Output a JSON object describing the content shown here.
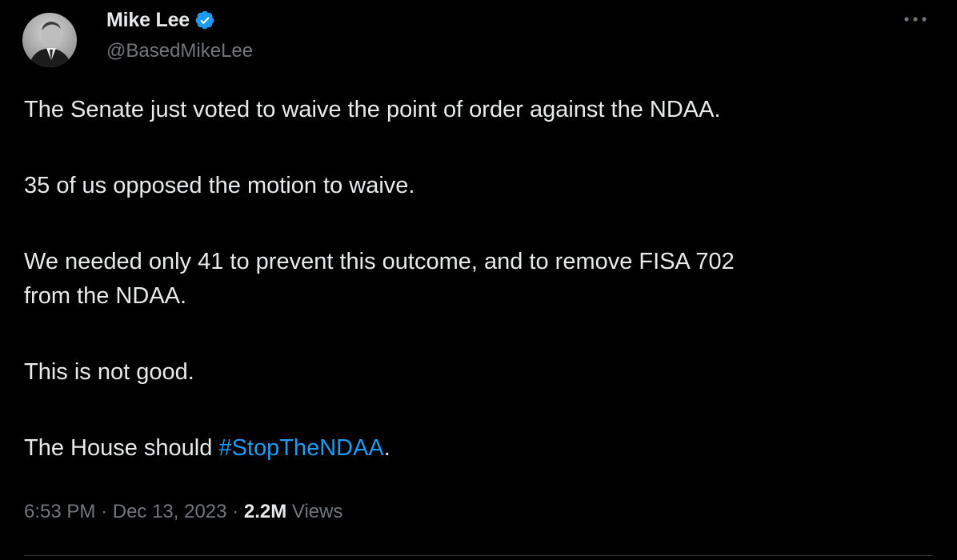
{
  "author": {
    "display_name": "Mike Lee",
    "handle": "@BasedMikeLee",
    "verified": true,
    "verified_color": "#1d9bf0"
  },
  "menu": {
    "icon": "more-horizontal-icon"
  },
  "tweet": {
    "paragraphs": [
      "The Senate just voted to waive the point of order against the NDAA.",
      "35 of us opposed the motion to waive.",
      "We needed only 41 to prevent this outcome, and to remove FISA 702",
      "from the NDAA.",
      "This is not good."
    ],
    "last_line_prefix": "The House should ",
    "hashtag": "#StopTheNDAA",
    "last_line_suffix": "."
  },
  "meta": {
    "time": "6:53 PM",
    "separator": "·",
    "date": "Dec 13, 2023",
    "views_count": "2.2M",
    "views_label": "Views"
  },
  "colors": {
    "background": "#000000",
    "text": "#e7e9ea",
    "secondary": "#71767b",
    "link": "#1d9bf0"
  }
}
